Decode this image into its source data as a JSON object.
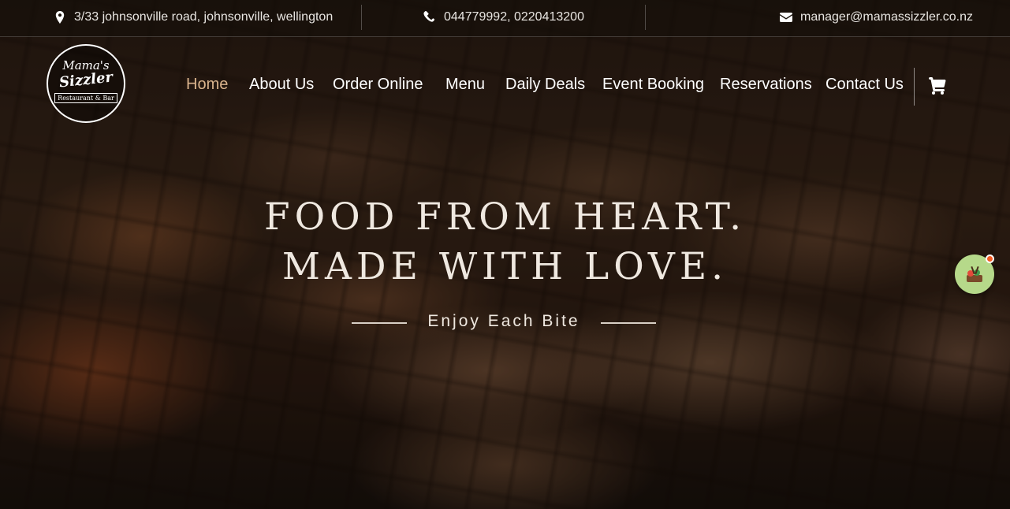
{
  "topbar": {
    "address": "3/33 johnsonville road, johnsonville, wellington",
    "phone": "044779992, 0220413200",
    "email": "manager@mamassizzler.co.nz"
  },
  "logo": {
    "line1": "Mama's",
    "line2": "Sizzler",
    "line3": "Restaurant & Bar"
  },
  "nav": {
    "items": [
      "Home",
      "About Us",
      "Order Online",
      "Menu",
      "Daily Deals",
      "Event Booking",
      "Reservations",
      "Contact Us"
    ],
    "active": "Home",
    "cart_icon": "shopping-cart-icon"
  },
  "hero": {
    "headline_line1": "FOOD FROM HEART.",
    "headline_line2": "MADE WITH LOVE.",
    "tagline": "Enjoy Each Bite"
  },
  "widget": {
    "icon": "food-order-widget-icon",
    "badge_color": "#f25a22"
  },
  "colors": {
    "accent": "#d9b38c",
    "widget_bg": "#b6d98a"
  }
}
